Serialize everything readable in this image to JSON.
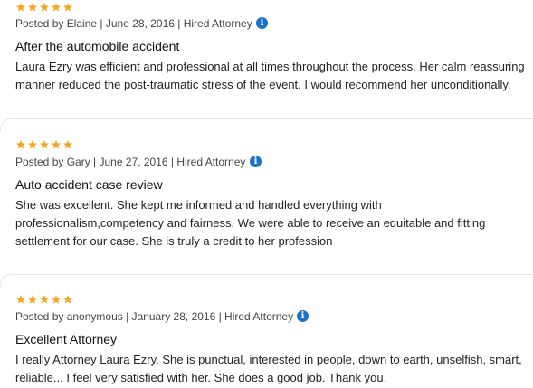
{
  "colors": {
    "star": "#f5a623",
    "info": "#1a73c9"
  },
  "reviews": [
    {
      "rating": 5,
      "meta": "Posted by Elaine | June 28, 2016 | Hired Attorney",
      "title": "After the automobile accident",
      "body": "Laura Ezry was efficient and professional at all times throughout the process. Her calm reassuring manner reduced the post-traumatic stress of the event. I would recommend her unconditionally."
    },
    {
      "rating": 5,
      "meta": "Posted by Gary | June 27, 2016 | Hired Attorney",
      "title": "Auto accident case review",
      "body": "She was excellent. She kept me informed and handled everything with professionalism,competency and fairness. We were able to receive an equitable and fitting settlement for our case. She is truly a credit to her profession"
    },
    {
      "rating": 5,
      "meta": "Posted by anonymous | January 28, 2016 | Hired Attorney",
      "title": "Excellent Attorney",
      "body": "I really Attorney Laura Ezry. She is punctual, interested in people, down to earth, unselfish, smart, reliable... I feel very satisfied with her. She does a good job. Thank you."
    }
  ]
}
